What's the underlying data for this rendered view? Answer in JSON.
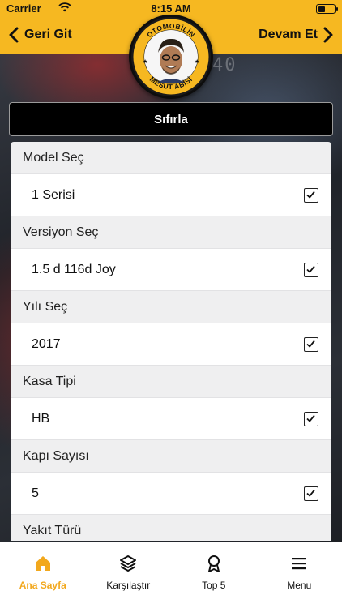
{
  "status_bar": {
    "carrier": "Carrier",
    "time": "8:15 AM",
    "battery_level": 0.4
  },
  "header": {
    "back_label": "Geri Git",
    "next_label": "Devam Et",
    "logo_top_text": "OTOMOBİLİN",
    "logo_bottom_text": "MESUT ABİSİ"
  },
  "background": {
    "readout": "40"
  },
  "reset_label": "Sıfırla",
  "form": {
    "sections": [
      {
        "title": "Model Seç",
        "value": "1 Serisi",
        "checked": true
      },
      {
        "title": "Versiyon Seç",
        "value": "1.5 d 116d Joy",
        "checked": true
      },
      {
        "title": "Yılı Seç",
        "value": "2017",
        "checked": true
      },
      {
        "title": "Kasa Tipi",
        "value": "HB",
        "checked": true
      },
      {
        "title": "Kapı Sayısı",
        "value": "5",
        "checked": true
      },
      {
        "title": "Yakıt Türü",
        "value": "",
        "checked": false
      }
    ]
  },
  "tabs": [
    {
      "label": "Ana Sayfa",
      "icon": "home-icon",
      "active": true
    },
    {
      "label": "Karşılaştır",
      "icon": "layers-icon",
      "active": false
    },
    {
      "label": "Top 5",
      "icon": "award-icon",
      "active": false
    },
    {
      "label": "Menu",
      "icon": "menu-icon",
      "active": false
    }
  ],
  "colors": {
    "header_yellow": "#f6b821",
    "active_tab": "#f2a81d",
    "reset_bg": "#000000"
  }
}
